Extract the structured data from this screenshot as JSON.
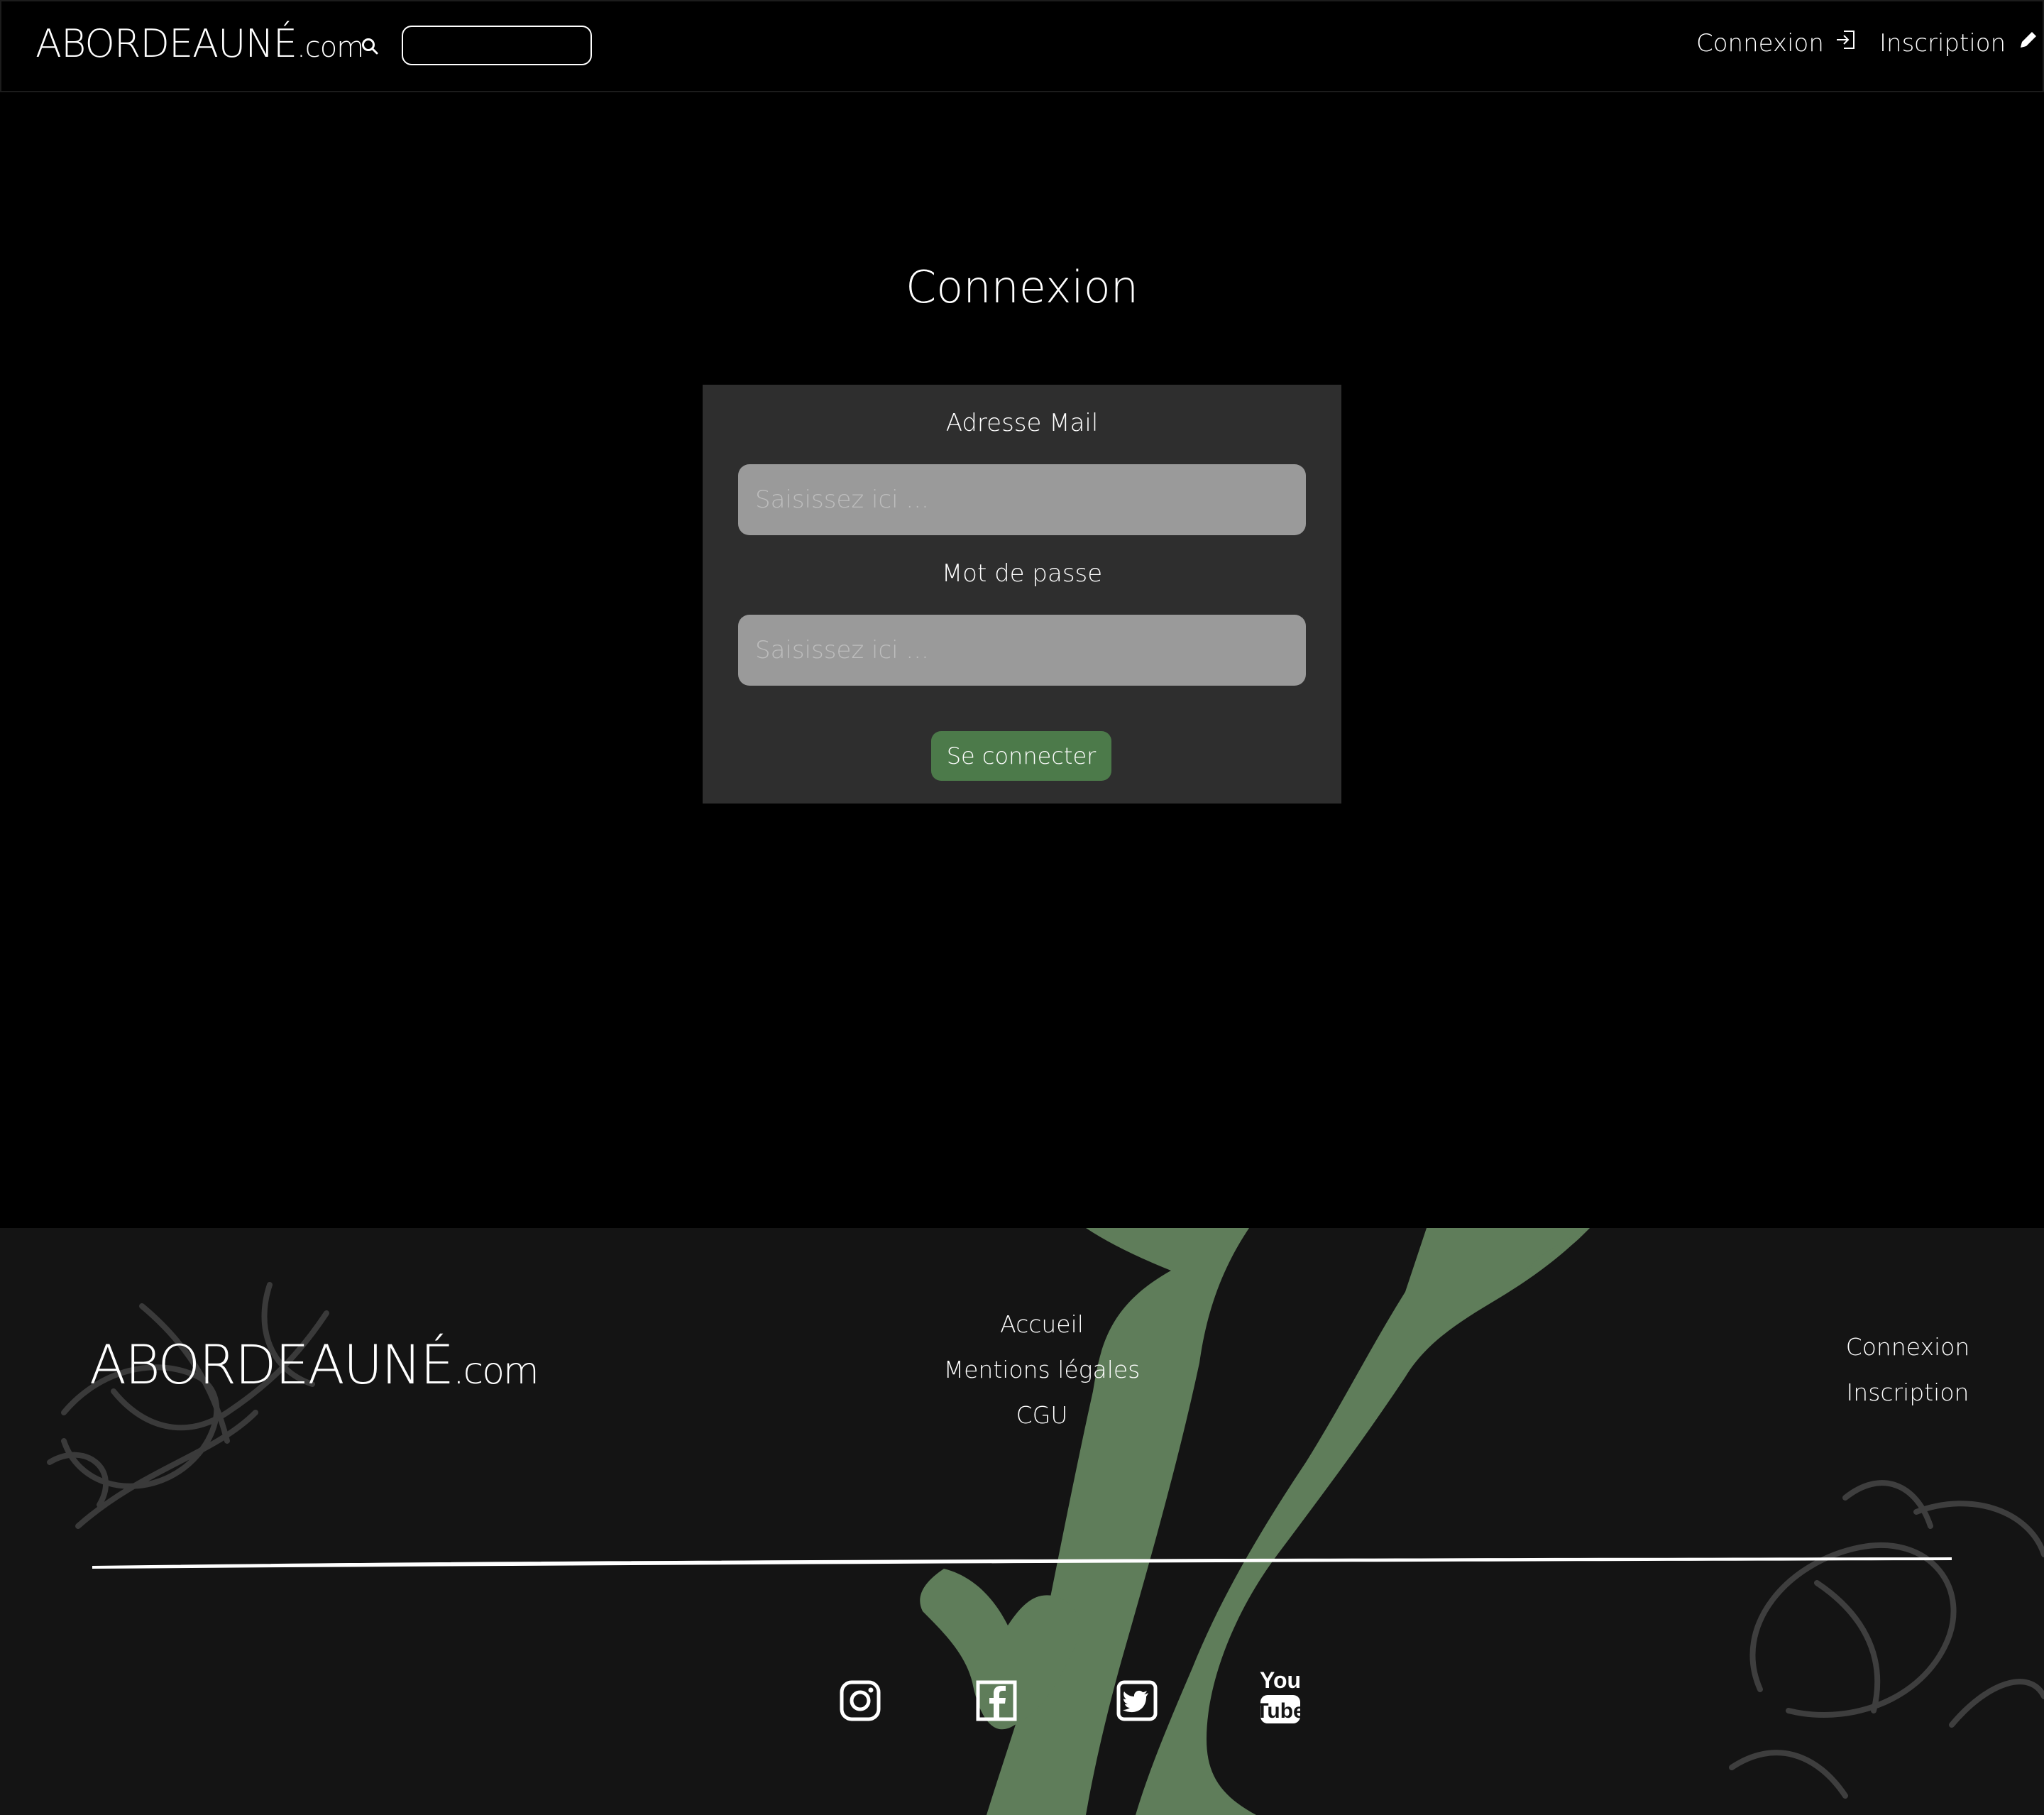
{
  "header": {
    "logo_main": "ABORDEAUNÉ",
    "logo_domain": ".com",
    "search_placeholder": "",
    "nav_login": "Connexion",
    "nav_signup": "Inscription"
  },
  "main": {
    "title": "Connexion",
    "email_label": "Adresse Mail",
    "email_placeholder": "Saisissez ici ...",
    "password_label": "Mot de passe",
    "password_placeholder": "Saisissez ici ...",
    "submit_label": "Se connecter"
  },
  "footer": {
    "logo_main": "ABORDEAUNÉ",
    "logo_domain": ".com",
    "links_center": [
      "Accueil",
      "Mentions légales",
      "CGU"
    ],
    "links_right": [
      "Connexion",
      "Inscription"
    ],
    "socials": [
      "instagram-icon",
      "facebook-icon",
      "twitter-icon",
      "youtube-icon"
    ]
  },
  "colors": {
    "background": "#000000",
    "card": "#2e2e2e",
    "input": "#9a9a9a",
    "button": "#4c7a4a",
    "footer": "#141414",
    "footer_accent": "#5f7d5a"
  }
}
